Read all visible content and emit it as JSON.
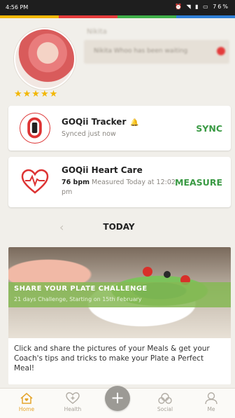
{
  "status_bar": {
    "time": "4:56 PM",
    "battery": "76%"
  },
  "profile": {
    "name": "Nikita",
    "coach_message": "Nikita Whoo has been waiting",
    "stars": "★★★★★"
  },
  "tracker_card": {
    "title": "GOQii Tracker",
    "subtitle": "Synced just now",
    "action": "SYNC"
  },
  "heart_card": {
    "title": "GOQii Heart Care",
    "bpm": "76 bpm",
    "subtitle": " Measured Today at 12:02 pm",
    "action": "MEASURE"
  },
  "date_selector": {
    "prev": "‹",
    "label": "TODAY"
  },
  "feature": {
    "title": "SHARE YOUR PLATE CHALLENGE",
    "meta": "21 days Challenge, Starting on 15th February",
    "description": "Click and share the pictures of your Meals & get your Coach's tips and tricks to make your Plate a Perfect Meal!"
  },
  "bottom_nav": {
    "home": "Home",
    "health": "Health",
    "add": "+",
    "social": "Social",
    "me": "Me"
  },
  "colors": {
    "accent_green": "#3a9a44",
    "brand_red": "#e43b3b",
    "home_active": "#e5a42b"
  }
}
